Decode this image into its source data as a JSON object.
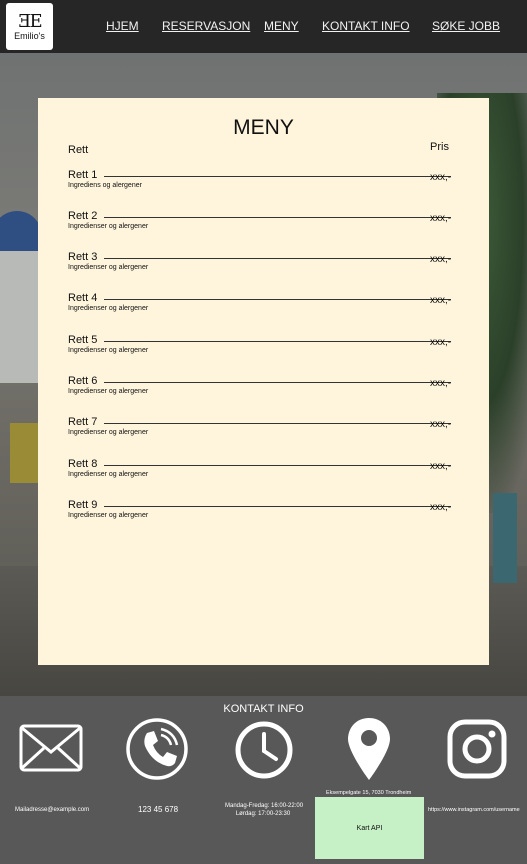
{
  "nav": {
    "logo_text": "Emilio's",
    "logo_mark": "ƎE",
    "links": [
      "HJEM",
      "RESERVASJON",
      "MENY",
      "KONTAKT INFO",
      "SØKE JOBB"
    ]
  },
  "menu": {
    "title": "MENY",
    "col_dish": "Rett",
    "col_price": "Pris",
    "items": [
      {
        "name": "Rett 1",
        "ingredients": "Ingrediens og alergener",
        "price": "xxx,-"
      },
      {
        "name": "Rett 2",
        "ingredients": "Ingredienser og alergener",
        "price": "xxx,-"
      },
      {
        "name": "Rett 3",
        "ingredients": "Ingredienser og alergener",
        "price": "xxx,-"
      },
      {
        "name": "Rett 4",
        "ingredients": "Ingredienser og alergener",
        "price": "xxx,-"
      },
      {
        "name": "Rett 5",
        "ingredients": "Ingredienser og alergener",
        "price": "xxx,-"
      },
      {
        "name": "Rett 6",
        "ingredients": "Ingredienser og alergener",
        "price": "xxx,-"
      },
      {
        "name": "Rett 7",
        "ingredients": "Ingredienser og alergener",
        "price": "xxx,-"
      },
      {
        "name": "Rett 8",
        "ingredients": "Ingredienser og alergener",
        "price": "xxx,-"
      },
      {
        "name": "Rett 9",
        "ingredients": "Ingredienser og alergener",
        "price": "xxx,-"
      }
    ]
  },
  "footer": {
    "title": "KONTAKT INFO",
    "email": "Mailadresse@example.com",
    "phone": "123 45 678",
    "hours_weekday": "Mandag-Fredag: 16:00-22:00",
    "hours_saturday": "Lørdag: 17:00-23:30",
    "address": "Eksempelgate 15, 7030 Trondheim",
    "map_label": "Kart API",
    "instagram": "https://www.instagram.com/username",
    "icons": [
      "mail-icon",
      "phone-icon",
      "clock-icon",
      "location-pin-icon",
      "instagram-icon"
    ],
    "map_color": "#c6f0c6"
  },
  "colors": {
    "nav_bg": "#262626",
    "card_bg": "#fff5dc",
    "footer_bg": "#585858"
  }
}
